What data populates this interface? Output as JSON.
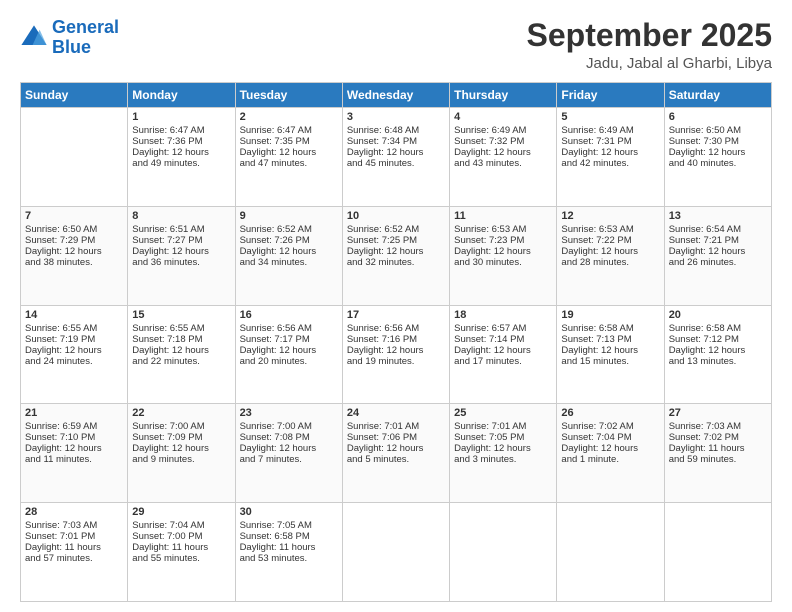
{
  "logo": {
    "line1": "General",
    "line2": "Blue"
  },
  "title": "September 2025",
  "location": "Jadu, Jabal al Gharbi, Libya",
  "days_header": [
    "Sunday",
    "Monday",
    "Tuesday",
    "Wednesday",
    "Thursday",
    "Friday",
    "Saturday"
  ],
  "weeks": [
    [
      {
        "day": "",
        "text": ""
      },
      {
        "day": "1",
        "text": "Sunrise: 6:47 AM\nSunset: 7:36 PM\nDaylight: 12 hours\nand 49 minutes."
      },
      {
        "day": "2",
        "text": "Sunrise: 6:47 AM\nSunset: 7:35 PM\nDaylight: 12 hours\nand 47 minutes."
      },
      {
        "day": "3",
        "text": "Sunrise: 6:48 AM\nSunset: 7:34 PM\nDaylight: 12 hours\nand 45 minutes."
      },
      {
        "day": "4",
        "text": "Sunrise: 6:49 AM\nSunset: 7:32 PM\nDaylight: 12 hours\nand 43 minutes."
      },
      {
        "day": "5",
        "text": "Sunrise: 6:49 AM\nSunset: 7:31 PM\nDaylight: 12 hours\nand 42 minutes."
      },
      {
        "day": "6",
        "text": "Sunrise: 6:50 AM\nSunset: 7:30 PM\nDaylight: 12 hours\nand 40 minutes."
      }
    ],
    [
      {
        "day": "7",
        "text": "Sunrise: 6:50 AM\nSunset: 7:29 PM\nDaylight: 12 hours\nand 38 minutes."
      },
      {
        "day": "8",
        "text": "Sunrise: 6:51 AM\nSunset: 7:27 PM\nDaylight: 12 hours\nand 36 minutes."
      },
      {
        "day": "9",
        "text": "Sunrise: 6:52 AM\nSunset: 7:26 PM\nDaylight: 12 hours\nand 34 minutes."
      },
      {
        "day": "10",
        "text": "Sunrise: 6:52 AM\nSunset: 7:25 PM\nDaylight: 12 hours\nand 32 minutes."
      },
      {
        "day": "11",
        "text": "Sunrise: 6:53 AM\nSunset: 7:23 PM\nDaylight: 12 hours\nand 30 minutes."
      },
      {
        "day": "12",
        "text": "Sunrise: 6:53 AM\nSunset: 7:22 PM\nDaylight: 12 hours\nand 28 minutes."
      },
      {
        "day": "13",
        "text": "Sunrise: 6:54 AM\nSunset: 7:21 PM\nDaylight: 12 hours\nand 26 minutes."
      }
    ],
    [
      {
        "day": "14",
        "text": "Sunrise: 6:55 AM\nSunset: 7:19 PM\nDaylight: 12 hours\nand 24 minutes."
      },
      {
        "day": "15",
        "text": "Sunrise: 6:55 AM\nSunset: 7:18 PM\nDaylight: 12 hours\nand 22 minutes."
      },
      {
        "day": "16",
        "text": "Sunrise: 6:56 AM\nSunset: 7:17 PM\nDaylight: 12 hours\nand 20 minutes."
      },
      {
        "day": "17",
        "text": "Sunrise: 6:56 AM\nSunset: 7:16 PM\nDaylight: 12 hours\nand 19 minutes."
      },
      {
        "day": "18",
        "text": "Sunrise: 6:57 AM\nSunset: 7:14 PM\nDaylight: 12 hours\nand 17 minutes."
      },
      {
        "day": "19",
        "text": "Sunrise: 6:58 AM\nSunset: 7:13 PM\nDaylight: 12 hours\nand 15 minutes."
      },
      {
        "day": "20",
        "text": "Sunrise: 6:58 AM\nSunset: 7:12 PM\nDaylight: 12 hours\nand 13 minutes."
      }
    ],
    [
      {
        "day": "21",
        "text": "Sunrise: 6:59 AM\nSunset: 7:10 PM\nDaylight: 12 hours\nand 11 minutes."
      },
      {
        "day": "22",
        "text": "Sunrise: 7:00 AM\nSunset: 7:09 PM\nDaylight: 12 hours\nand 9 minutes."
      },
      {
        "day": "23",
        "text": "Sunrise: 7:00 AM\nSunset: 7:08 PM\nDaylight: 12 hours\nand 7 minutes."
      },
      {
        "day": "24",
        "text": "Sunrise: 7:01 AM\nSunset: 7:06 PM\nDaylight: 12 hours\nand 5 minutes."
      },
      {
        "day": "25",
        "text": "Sunrise: 7:01 AM\nSunset: 7:05 PM\nDaylight: 12 hours\nand 3 minutes."
      },
      {
        "day": "26",
        "text": "Sunrise: 7:02 AM\nSunset: 7:04 PM\nDaylight: 12 hours\nand 1 minute."
      },
      {
        "day": "27",
        "text": "Sunrise: 7:03 AM\nSunset: 7:02 PM\nDaylight: 11 hours\nand 59 minutes."
      }
    ],
    [
      {
        "day": "28",
        "text": "Sunrise: 7:03 AM\nSunset: 7:01 PM\nDaylight: 11 hours\nand 57 minutes."
      },
      {
        "day": "29",
        "text": "Sunrise: 7:04 AM\nSunset: 7:00 PM\nDaylight: 11 hours\nand 55 minutes."
      },
      {
        "day": "30",
        "text": "Sunrise: 7:05 AM\nSunset: 6:58 PM\nDaylight: 11 hours\nand 53 minutes."
      },
      {
        "day": "",
        "text": ""
      },
      {
        "day": "",
        "text": ""
      },
      {
        "day": "",
        "text": ""
      },
      {
        "day": "",
        "text": ""
      }
    ]
  ]
}
